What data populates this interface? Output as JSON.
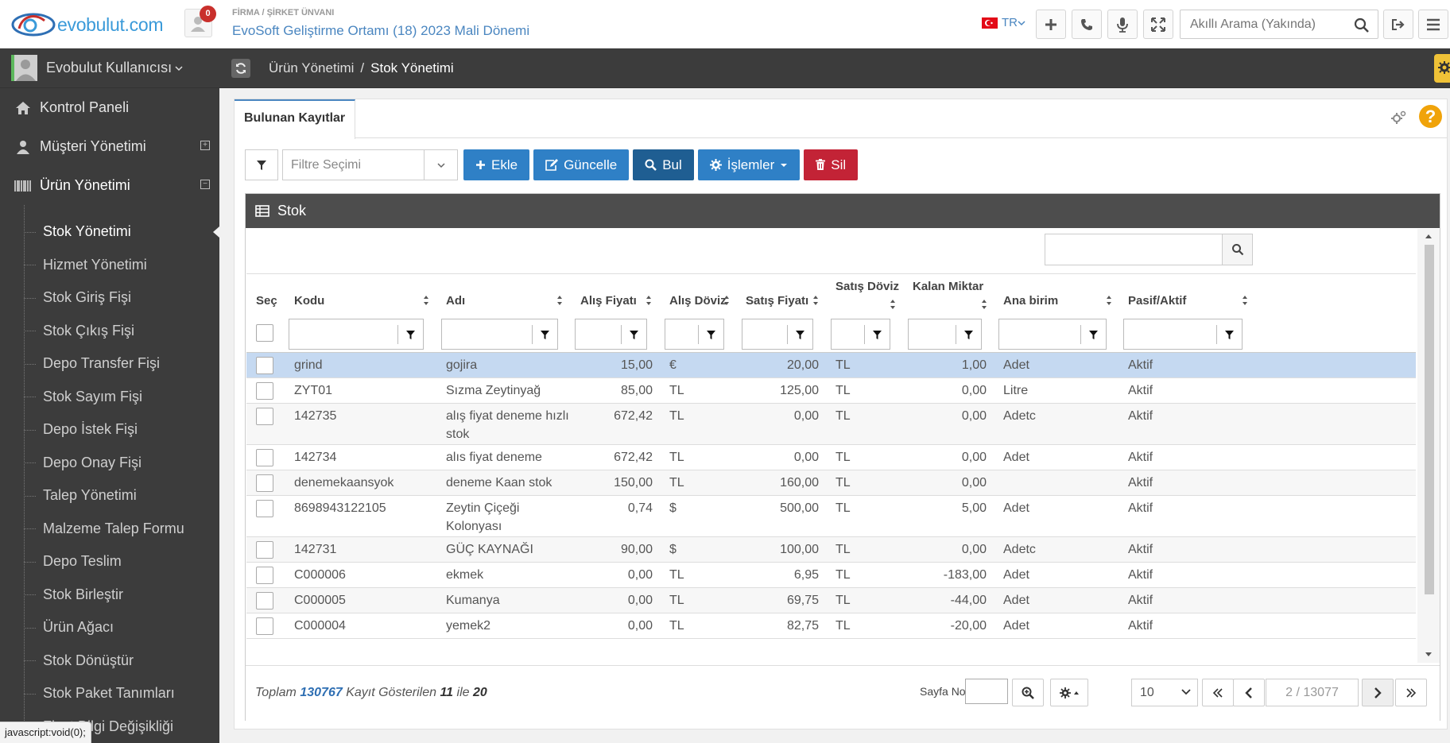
{
  "header": {
    "logo_text": "evobulut.com",
    "notification_count": "0",
    "company_label": "FİRMA / ŞİRKET ÜNVANI",
    "company_name": "EvoSoft Geliştirme Ortamı (18) 2023 Mali Dönemi",
    "language": "TR",
    "search_placeholder": "Akıllı Arama (Yakında)"
  },
  "sidebar": {
    "user_name": "Evobulut Kullanıcısı",
    "menu": [
      {
        "label": "Kontrol Paneli"
      },
      {
        "label": "Müşteri Yönetimi"
      },
      {
        "label": "Ürün Yönetimi"
      }
    ],
    "submenu": [
      {
        "label": "Stok Yönetimi"
      },
      {
        "label": "Hizmet Yönetimi"
      },
      {
        "label": "Stok Giriş Fişi"
      },
      {
        "label": "Stok Çıkış Fişi"
      },
      {
        "label": "Depo Transfer Fişi"
      },
      {
        "label": "Stok Sayım Fişi"
      },
      {
        "label": "Depo İstek Fişi"
      },
      {
        "label": "Depo Onay Fişi"
      },
      {
        "label": "Talep Yönetimi"
      },
      {
        "label": "Malzeme Talep Formu"
      },
      {
        "label": "Depo Teslim"
      },
      {
        "label": "Stok Birleştir"
      },
      {
        "label": "Ürün Ağacı"
      },
      {
        "label": "Stok Dönüştür"
      },
      {
        "label": "Stok Paket Tanımları"
      },
      {
        "label": "Fiyat Bilgi Değişikliği"
      }
    ],
    "status_text": "javascript:void(0);"
  },
  "breadcrumb": {
    "parent": "Ürün Yönetimi",
    "separator": "/",
    "current": "Stok Yönetimi"
  },
  "panel": {
    "tab_label": "Bulunan Kayıtlar",
    "help": "?"
  },
  "toolbar": {
    "filter_placeholder": "Filtre Seçimi",
    "add": "Ekle",
    "update": "Güncelle",
    "find": "Bul",
    "ops": "İşlemler",
    "delete": "Sil"
  },
  "grid": {
    "title": "Stok",
    "columns": {
      "select": "Seç",
      "code": "Kodu",
      "name": "Adı",
      "buy_price": "Alış Fiyatı",
      "buy_currency": "Alış Döviz",
      "sell_price": "Satış Fiyatı",
      "sell_currency": "Satış Döviz",
      "remaining": "Kalan Miktar",
      "unit": "Ana birim",
      "status": "Pasif/Aktif"
    },
    "rows": [
      {
        "code": "grind",
        "name": "gojira",
        "buy": "15,00",
        "buy_cur": "€",
        "sell": "20,00",
        "sell_cur": "TL",
        "qty": "1,00",
        "unit": "Adet",
        "status": "Aktif"
      },
      {
        "code": "ZYT01",
        "name": "Sızma Zeytinyağ",
        "buy": "85,00",
        "buy_cur": "TL",
        "sell": "125,00",
        "sell_cur": "TL",
        "qty": "0,00",
        "unit": "Litre",
        "status": "Aktif"
      },
      {
        "code": "142735",
        "name": "alış fiyat deneme hızlı stok",
        "buy": "672,42",
        "buy_cur": "TL",
        "sell": "0,00",
        "sell_cur": "TL",
        "qty": "0,00",
        "unit": "Adetc",
        "status": "Aktif"
      },
      {
        "code": "142734",
        "name": "alıs fiyat deneme",
        "buy": "672,42",
        "buy_cur": "TL",
        "sell": "0,00",
        "sell_cur": "TL",
        "qty": "0,00",
        "unit": "Adet",
        "status": "Aktif"
      },
      {
        "code": "denemekaansyok",
        "name": "deneme Kaan stok",
        "buy": "150,00",
        "buy_cur": "TL",
        "sell": "160,00",
        "sell_cur": "TL",
        "qty": "0,00",
        "unit": "",
        "status": "Aktif"
      },
      {
        "code": "8698943122105",
        "name": "Zeytin Çiçeği Kolonyası",
        "buy": "0,74",
        "buy_cur": "$",
        "sell": "500,00",
        "sell_cur": "TL",
        "qty": "5,00",
        "unit": "Adet",
        "status": "Aktif"
      },
      {
        "code": "142731",
        "name": "GÜÇ KAYNAĞI",
        "buy": "90,00",
        "buy_cur": "$",
        "sell": "100,00",
        "sell_cur": "TL",
        "qty": "0,00",
        "unit": "Adetc",
        "status": "Aktif"
      },
      {
        "code": "C000006",
        "name": "ekmek",
        "buy": "0,00",
        "buy_cur": "TL",
        "sell": "6,95",
        "sell_cur": "TL",
        "qty": "-183,00",
        "unit": "Adet",
        "status": "Aktif"
      },
      {
        "code": "C000005",
        "name": "Kumanya",
        "buy": "0,00",
        "buy_cur": "TL",
        "sell": "69,75",
        "sell_cur": "TL",
        "qty": "-44,00",
        "unit": "Adet",
        "status": "Aktif"
      },
      {
        "code": "C000004",
        "name": "yemek2",
        "buy": "0,00",
        "buy_cur": "TL",
        "sell": "82,75",
        "sell_cur": "TL",
        "qty": "-20,00",
        "unit": "Adet",
        "status": "Aktif"
      }
    ]
  },
  "footer": {
    "total_label": "Toplam",
    "total": "130767",
    "shown_label": "Kayıt Gösterilen",
    "from": "11",
    "to_label": "ile",
    "to": "20",
    "page_label": "Sayfa No :",
    "page_size": "10",
    "page_info": "2 / 13077"
  }
}
